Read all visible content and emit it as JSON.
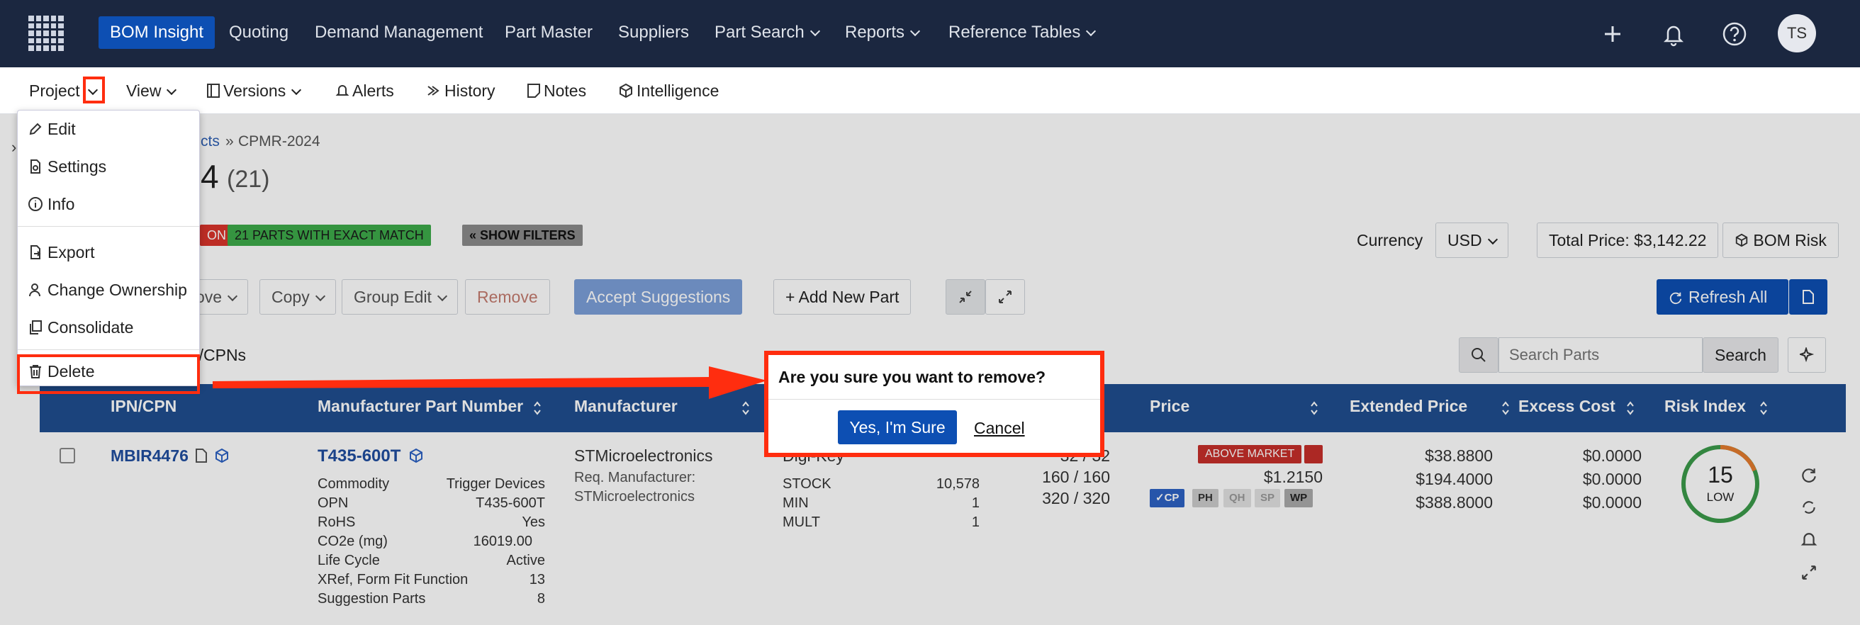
{
  "topnav": {
    "items": [
      "BOM Insight",
      "Quoting",
      "Demand Management",
      "Part Master",
      "Suppliers",
      "Part Search",
      "Reports",
      "Reference Tables"
    ],
    "avatar_initials": "TS"
  },
  "subnav": {
    "project": "Project",
    "view": "View",
    "versions": "Versions",
    "alerts": "Alerts",
    "history": "History",
    "notes": "Notes",
    "intelligence": "Intelligence"
  },
  "breadcrumb": {
    "projects": "cts",
    "sep": "»",
    "current": "CPMR-2024"
  },
  "title": {
    "suffix": "4",
    "count": "(21)"
  },
  "badges": {
    "red": "ON",
    "green": "21 PARTS WITH EXACT MATCH",
    "filters": "« SHOW FILTERS"
  },
  "currency": {
    "label": "Currency",
    "value": "USD"
  },
  "total_price": "Total Price: $3,142.22",
  "bom_risk": "BOM Risk",
  "toolbar": {
    "move": "ove",
    "copy": "Copy",
    "group_edit": "Group Edit",
    "remove": "Remove",
    "accept": "Accept Suggestions",
    "add_part": "+ Add New Part",
    "refresh": "Refresh All"
  },
  "table_title": "N/CPNs",
  "search": {
    "placeholder": "Search Parts",
    "button": "Search"
  },
  "columns": [
    "IPN/CPN",
    "Manufacturer Part Number",
    "Manufacturer",
    "Price",
    "Extended Price",
    "Excess Cost",
    "Risk Index"
  ],
  "row": {
    "ipn": "MBIR4476",
    "mpn": "T435-600T",
    "details": [
      [
        "Commodity",
        "Trigger Devices"
      ],
      [
        "OPN",
        "T435-600T"
      ],
      [
        "RoHS",
        "Yes"
      ],
      [
        "CO2e (mg)",
        "16019.00"
      ],
      [
        "Life Cycle",
        "Active"
      ],
      [
        "XRef, Form Fit Function",
        "13"
      ],
      [
        "Suggestion Parts",
        "8"
      ]
    ],
    "manufacturer": "STMicroelectronics",
    "req_label": "Req. Manufacturer:",
    "req_value": "STMicroelectronics",
    "partial": "Digi-Key",
    "stock": [
      [
        "STOCK",
        "10,578"
      ],
      [
        "MIN",
        "1"
      ],
      [
        "MULT",
        "1"
      ]
    ],
    "qty": [
      "32 / 32",
      "160 / 160",
      "320 / 320"
    ],
    "market": "ABOVE MARKET",
    "unit_price": "$1.2150",
    "chips": [
      "✓CP",
      "PH",
      "QH",
      "SP",
      "WP"
    ],
    "extended": [
      "$38.8800",
      "$194.4000",
      "$388.8000"
    ],
    "excess": [
      "$0.0000",
      "$0.0000",
      "$0.0000"
    ],
    "risk_value": "15",
    "risk_label": "LOW"
  },
  "menu": {
    "items": [
      "Edit",
      "Settings",
      "Info",
      "Export",
      "Change Ownership",
      "Consolidate",
      "Delete"
    ]
  },
  "modal": {
    "message": "Are you sure you want to remove?",
    "confirm": "Yes, I'm Sure",
    "cancel": "Cancel"
  },
  "colors": {
    "nav": "#1b2740",
    "accent": "#0d4fb3",
    "header": "#1f4d8f",
    "callout": "#ff2d0f"
  }
}
